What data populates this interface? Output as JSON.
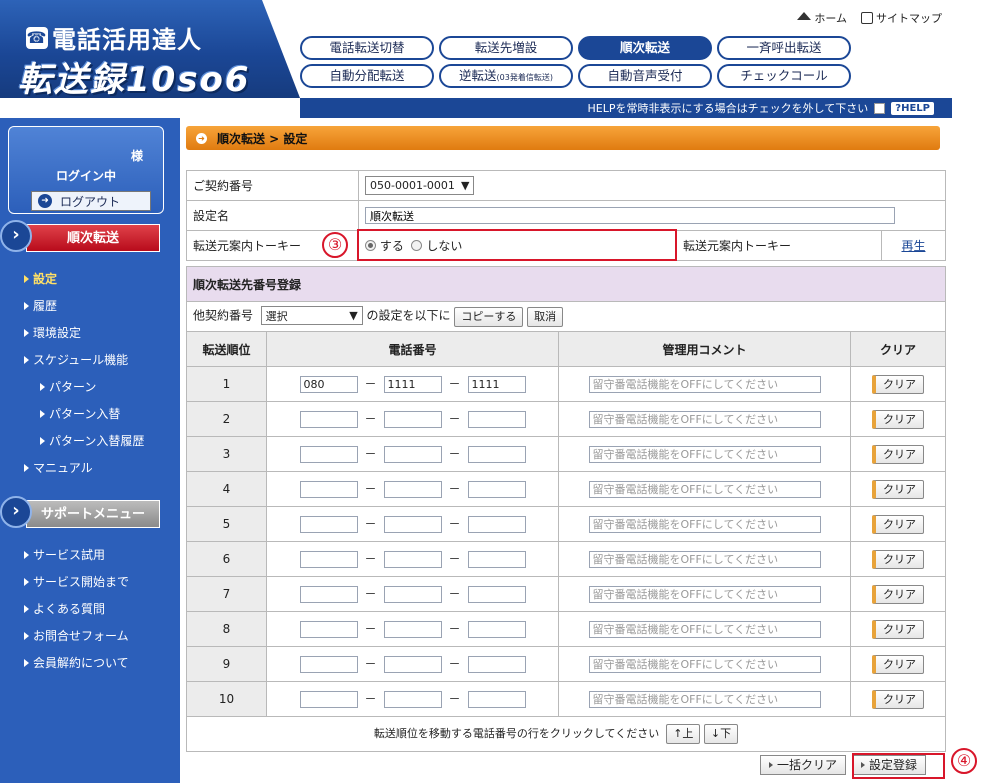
{
  "header": {
    "logo_line1": "電話活用達人",
    "logo_line2": "転送録10so6",
    "top_links": [
      {
        "label": "ホーム",
        "icon": "home-icon"
      },
      {
        "label": "サイトマップ",
        "icon": "sitemap-icon"
      }
    ],
    "nav": [
      {
        "label": "電話転送切替",
        "active": false
      },
      {
        "label": "転送先増設",
        "active": false
      },
      {
        "label": "順次転送",
        "active": true
      },
      {
        "label": "一斉呼出転送",
        "active": false
      },
      {
        "label": "自動分配転送",
        "active": false
      },
      {
        "label": "逆転送",
        "small": "(03発着信転送)",
        "active": false
      },
      {
        "label": "自動音声受付",
        "active": false
      },
      {
        "label": "チェックコール",
        "active": false
      }
    ],
    "help_text": "HELPを常時非表示にする場合はチェックを外して下さい",
    "help_badge": "?HELP"
  },
  "sidebar": {
    "sama": "様",
    "login_status": "ログイン中",
    "logout_label": "ログアウト",
    "section1_title": "順次転送",
    "section1_items": [
      "設定",
      "履歴",
      "環境設定",
      "スケジュール機能"
    ],
    "section1_subitems": [
      "パターン",
      "パターン入替",
      "パターン入替履歴"
    ],
    "manual": "マニュアル",
    "section2_title": "サポートメニュー",
    "section2_items": [
      "サービス試用",
      "サービス開始まで",
      "よくある質問",
      "お問合せフォーム",
      "会員解約について"
    ]
  },
  "breadcrumb": "順次転送 > 設定",
  "form": {
    "contract_label": "ご契約番号",
    "contract_value": "050-0001-0001",
    "setting_name_label": "設定名",
    "setting_name_value": "順次転送",
    "guidance_label": "転送元案内トーキー",
    "radio_yes": "する",
    "radio_no": "しない",
    "guidance_label2": "転送元案内トーキー",
    "play_link": "再生"
  },
  "dest": {
    "section_title": "順次転送先番号登録",
    "other_label": "他契約番号",
    "other_select": "選択",
    "copy_text": "の設定を以下に",
    "copy_btn": "コピーする",
    "cancel_btn": "取消",
    "col_order": "転送順位",
    "col_phone": "電話番号",
    "col_comment": "管理用コメント",
    "col_clear": "クリア",
    "comment_placeholder": "留守番電話機能をOFFにしてください",
    "clear_btn": "クリア",
    "dash": "－",
    "rows": [
      {
        "n": "1",
        "p1": "080",
        "p2": "1111",
        "p3": "1111"
      },
      {
        "n": "2",
        "p1": "",
        "p2": "",
        "p3": ""
      },
      {
        "n": "3",
        "p1": "",
        "p2": "",
        "p3": ""
      },
      {
        "n": "4",
        "p1": "",
        "p2": "",
        "p3": ""
      },
      {
        "n": "5",
        "p1": "",
        "p2": "",
        "p3": ""
      },
      {
        "n": "6",
        "p1": "",
        "p2": "",
        "p3": ""
      },
      {
        "n": "7",
        "p1": "",
        "p2": "",
        "p3": ""
      },
      {
        "n": "8",
        "p1": "",
        "p2": "",
        "p3": ""
      },
      {
        "n": "9",
        "p1": "",
        "p2": "",
        "p3": ""
      },
      {
        "n": "10",
        "p1": "",
        "p2": "",
        "p3": ""
      }
    ],
    "move_text": "転送順位を移動する電話番号の行をクリックしてください",
    "up_btn": "↑上",
    "down_btn": "↓下"
  },
  "footer": {
    "clear_all": "一括クリア",
    "register": "設定登録"
  },
  "annotations": {
    "n3": "③",
    "n4": "④",
    "color": "#d8162a"
  }
}
